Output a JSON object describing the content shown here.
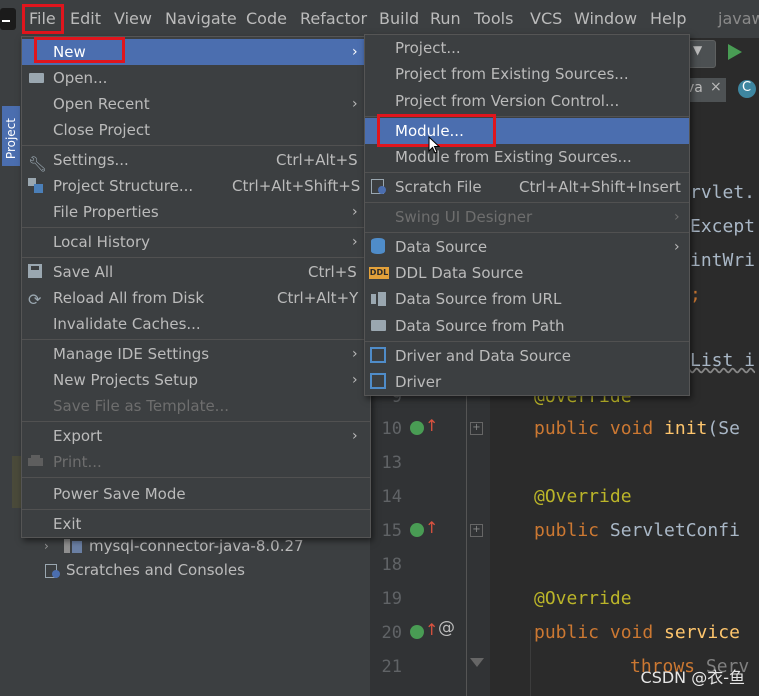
{
  "menubar": {
    "items": [
      "File",
      "Edit",
      "View",
      "Navigate",
      "Code",
      "Refactor",
      "Build",
      "Run",
      "Tools",
      "VCS",
      "Window",
      "Help"
    ],
    "project_title": "javaw"
  },
  "sidebar": {
    "tool_label": "Project"
  },
  "file_menu": {
    "items": [
      {
        "label": "New",
        "shortcut": "",
        "submenu": true
      },
      {
        "label": "Open...",
        "shortcut": ""
      },
      {
        "label": "Open Recent",
        "shortcut": "",
        "submenu": true
      },
      {
        "label": "Close Project",
        "shortcut": ""
      },
      {
        "label": "Settings...",
        "shortcut": "Ctrl+Alt+S"
      },
      {
        "label": "Project Structure...",
        "shortcut": "Ctrl+Alt+Shift+S"
      },
      {
        "label": "File Properties",
        "shortcut": "",
        "submenu": true
      },
      {
        "label": "Local History",
        "shortcut": "",
        "submenu": true
      },
      {
        "label": "Save All",
        "shortcut": "Ctrl+S"
      },
      {
        "label": "Reload All from Disk",
        "shortcut": "Ctrl+Alt+Y"
      },
      {
        "label": "Invalidate Caches...",
        "shortcut": ""
      },
      {
        "label": "Manage IDE Settings",
        "shortcut": "",
        "submenu": true
      },
      {
        "label": "New Projects Setup",
        "shortcut": "",
        "submenu": true
      },
      {
        "label": "Save File as Template...",
        "shortcut": "",
        "disabled": true
      },
      {
        "label": "Export",
        "shortcut": "",
        "submenu": true
      },
      {
        "label": "Print...",
        "shortcut": "",
        "disabled": true
      },
      {
        "label": "Power Save Mode",
        "shortcut": ""
      },
      {
        "label": "Exit",
        "shortcut": ""
      }
    ]
  },
  "new_menu": {
    "items": [
      {
        "label": "Project...",
        "shortcut": ""
      },
      {
        "label": "Project from Existing Sources...",
        "shortcut": ""
      },
      {
        "label": "Project from Version Control...",
        "shortcut": ""
      },
      {
        "label": "Module...",
        "shortcut": ""
      },
      {
        "label": "Module from Existing Sources...",
        "shortcut": ""
      },
      {
        "label": "Scratch File",
        "shortcut": "Ctrl+Alt+Shift+Insert"
      },
      {
        "label": "Swing UI Designer",
        "shortcut": "",
        "disabled": true,
        "submenu": true
      },
      {
        "label": "Data Source",
        "shortcut": "",
        "submenu": true
      },
      {
        "label": "DDL Data Source",
        "shortcut": ""
      },
      {
        "label": "Data Source from URL",
        "shortcut": ""
      },
      {
        "label": "Data Source from Path",
        "shortcut": ""
      },
      {
        "label": "Driver and Data Source",
        "shortcut": ""
      },
      {
        "label": "Driver",
        "shortcut": ""
      }
    ]
  },
  "project_tree": {
    "items": [
      "mysql-connector-java-8.0.27",
      "Scratches and Consoles"
    ]
  },
  "editor": {
    "tab_partial": "va",
    "code_fragments": [
      "rvlet.",
      "Except",
      "intWri",
      ";",
      "List i"
    ],
    "lines": [
      {
        "num": "9",
        "code": "@Override"
      },
      {
        "num": "10",
        "kw": "public void ",
        "fn": "init",
        "rest": "(Se"
      },
      {
        "num": "13",
        "code": ""
      },
      {
        "num": "14",
        "code": "@Override"
      },
      {
        "num": "15",
        "kw": "public ",
        "rest": "ServletConfi"
      },
      {
        "num": "18",
        "code": ""
      },
      {
        "num": "19",
        "code": "@Override"
      },
      {
        "num": "20",
        "kw": "public void ",
        "fn": "service"
      },
      {
        "num": "21",
        "kw": "throws ",
        "rest": "Serv"
      }
    ]
  },
  "watermark": "CSDN @衣-鱼",
  "colors": {
    "accent": "#4b6eaf",
    "highlight_box": "#e0151d",
    "menu_bg": "#3c3f41"
  }
}
